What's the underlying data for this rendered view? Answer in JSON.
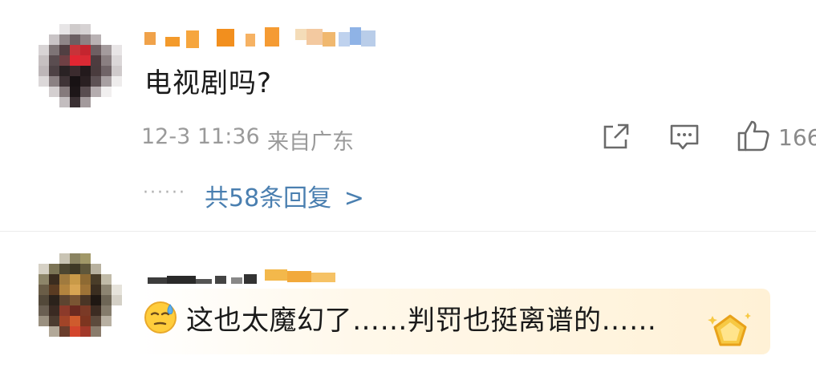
{
  "comment1": {
    "text": "电视剧吗?",
    "time": "12-3 11:36",
    "location": "来自广东",
    "likes": "166",
    "replies_label": "共58条回复",
    "replies_chevron": ">",
    "dots": "······"
  },
  "comment2": {
    "text": "这也太魔幻了……判罚也挺离谱的……"
  },
  "icons": {
    "share": "share-icon",
    "comment": "comment-icon",
    "like": "thumbs-up-icon",
    "emoji": "sweat-face-emoji",
    "badge": "gold-badge-icon"
  },
  "colors": {
    "text": "#1a1a1a",
    "meta": "#9a9a9a",
    "link": "#4a7fb0",
    "nick_orange": "#f39a2b"
  }
}
